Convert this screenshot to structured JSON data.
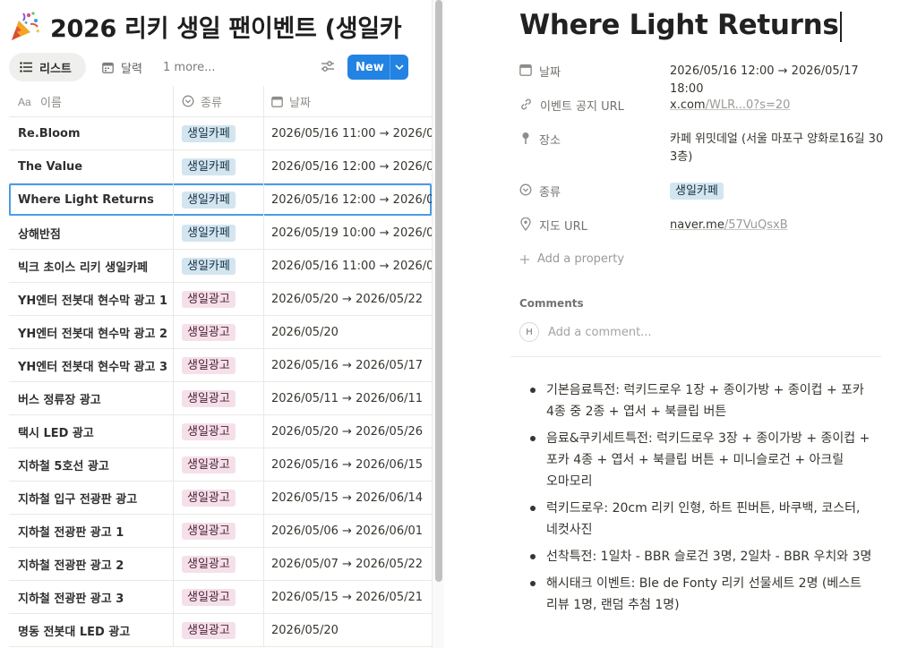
{
  "database": {
    "title": "2026 리키 생일 팬이벤트 (생일카",
    "icon": "party-popper-icon",
    "views": [
      {
        "label": "리스트",
        "icon": "list-icon"
      },
      {
        "label": "달력",
        "icon": "calendar-icon"
      }
    ],
    "more_views": "1 more...",
    "new_button": "New",
    "columns": [
      {
        "label": "이름",
        "icon": "text-property-icon"
      },
      {
        "label": "종류",
        "icon": "select-property-icon"
      },
      {
        "label": "날짜",
        "icon": "calendar-icon"
      }
    ],
    "rows": [
      {
        "name": "Re.Bloom",
        "type": "생일카페",
        "tag_color": "blue",
        "date": "2026/05/16 11:00 → 2026/05"
      },
      {
        "name": "The Value",
        "type": "생일카페",
        "tag_color": "blue",
        "date": "2026/05/16 12:00 → 2026/05"
      },
      {
        "name": "Where Light Returns",
        "type": "생일카페",
        "tag_color": "blue",
        "date": "2026/05/16 12:00 → 2026/05",
        "selected": true
      },
      {
        "name": "상해반점",
        "type": "생일카페",
        "tag_color": "blue",
        "date": "2026/05/19 10:00 → 2026/05"
      },
      {
        "name": "빅크 초이스 리키 생일카페",
        "type": "생일카페",
        "tag_color": "blue",
        "date": "2026/05/16 11:00 → 2026/05"
      },
      {
        "name": "YH엔터 전봇대 현수막 광고 1",
        "type": "생일광고",
        "tag_color": "pink",
        "date": "2026/05/20 → 2026/05/22"
      },
      {
        "name": "YH엔터 전봇대 현수막 광고 2",
        "type": "생일광고",
        "tag_color": "pink",
        "date": "2026/05/20"
      },
      {
        "name": "YH엔터 전봇대 현수막 광고 3",
        "type": "생일광고",
        "tag_color": "pink",
        "date": "2026/05/16 → 2026/05/17"
      },
      {
        "name": "버스 정류장 광고",
        "type": "생일광고",
        "tag_color": "pink",
        "date": "2026/05/11 → 2026/06/11"
      },
      {
        "name": "택시 LED 광고",
        "type": "생일광고",
        "tag_color": "pink",
        "date": "2026/05/20 → 2026/05/26"
      },
      {
        "name": "지하철 5호선 광고",
        "type": "생일광고",
        "tag_color": "pink",
        "date": "2026/05/16 → 2026/06/15"
      },
      {
        "name": "지하철 입구 전광판 광고",
        "type": "생일광고",
        "tag_color": "pink",
        "date": "2026/05/15 → 2026/06/14"
      },
      {
        "name": "지하철 전광판 광고 1",
        "type": "생일광고",
        "tag_color": "pink",
        "date": "2026/05/06 → 2026/06/01"
      },
      {
        "name": "지하철 전광판 광고 2",
        "type": "생일광고",
        "tag_color": "pink",
        "date": "2026/05/07 → 2026/05/22"
      },
      {
        "name": "지하철 전광판 광고 3",
        "type": "생일광고",
        "tag_color": "pink",
        "date": "2026/05/15 → 2026/05/21"
      },
      {
        "name": "명동 전봇대 LED 광고",
        "type": "생일광고",
        "tag_color": "pink",
        "date": "2026/05/20"
      }
    ]
  },
  "page": {
    "title": "Where Light Returns",
    "properties": {
      "date": {
        "label": "날짜",
        "value": "2026/05/16 12:00 → 2026/05/17 18:00"
      },
      "url": {
        "label": "이벤트 공지 URL",
        "value_main": "x.com",
        "value_dim": "/WLR...0?s=20"
      },
      "place": {
        "label": "장소",
        "value": "카페 위밋데얼 (서울 마포구 양화로16길 30 3층)"
      },
      "type": {
        "label": "종류",
        "value": "생일카페"
      },
      "map": {
        "label": "지도 URL",
        "value_main": "naver.me",
        "value_dim": "/57VuQsxB"
      }
    },
    "add_property": "Add a property",
    "comments_label": "Comments",
    "comment_avatar": "H",
    "comment_placeholder": "Add a comment...",
    "bullets": [
      "기본음료특전: 럭키드로우 1장 + 종이가방 + 종이컵 + 포카 4종 중 2종 + 엽서 + 북클립 버튼",
      "음료&쿠키세트특전: 럭키드로우 3장 + 종이가방 + 종이컵 + 포카 4종 + 엽서 + 북클립 버튼 + 미니슬로건 + 아크릴 오마모리",
      "럭키드로우: 20cm 리키 인형, 하트 핀버튼, 바쿠백, 코스터, 네컷사진",
      "선착특전: 1일차 - BBR 슬로건 3명, 2일차 - BBR 우치와 3명",
      "해시태크 이벤트: Ble de Fonty 리키 선물세트 2명 (베스트 리뷰 1명, 랜덤 추첨 1명)"
    ]
  },
  "colors": {
    "accent": "#2383e2",
    "tag_blue_bg": "#d3e5ef",
    "tag_pink_bg": "#f5e0e9",
    "selection": "#4c9be8"
  }
}
